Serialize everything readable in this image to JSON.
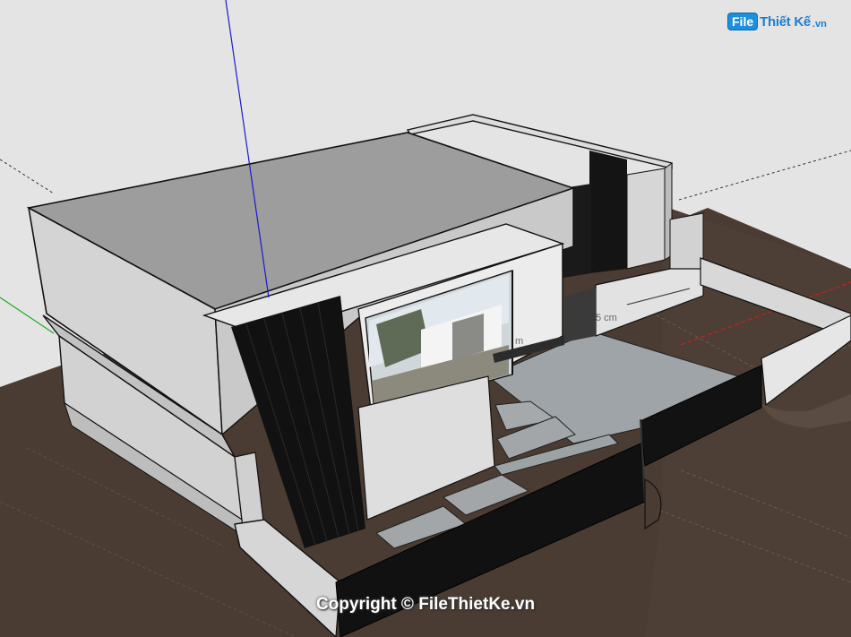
{
  "logo": {
    "file": "File",
    "name": "Thiết Kế",
    "tld": ".vn"
  },
  "dimension_label": "5 cm",
  "dimension_label_2": "m",
  "copyright": "Copyright © FileThietKe.vn",
  "colors": {
    "sky": "#e4e4e4",
    "ground": "#4a3c32",
    "wall_light": "#d9d9d9",
    "wall_shade": "#b4b4b4",
    "roof": "#9d9d9d",
    "louver": "#141414",
    "paving": "#9ea4a7",
    "axis_blue": "#1a1acc",
    "axis_green": "#1fae1f",
    "axis_red": "#cc2020"
  }
}
